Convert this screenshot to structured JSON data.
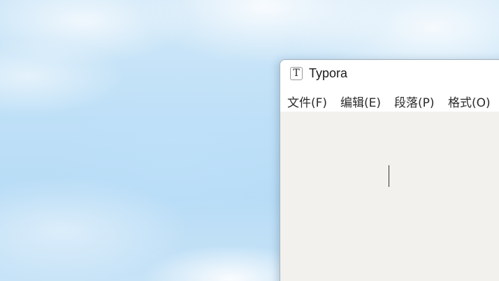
{
  "window": {
    "title": "Typora",
    "app_icon_letter": "T"
  },
  "menubar": {
    "items": [
      {
        "label": "文件(F)"
      },
      {
        "label": "编辑(E)"
      },
      {
        "label": "段落(P)"
      },
      {
        "label": "格式(O)"
      }
    ]
  },
  "editor": {
    "content": ""
  },
  "colors": {
    "editor_background": "#f2f1ee",
    "titlebar_background": "#ffffff"
  }
}
